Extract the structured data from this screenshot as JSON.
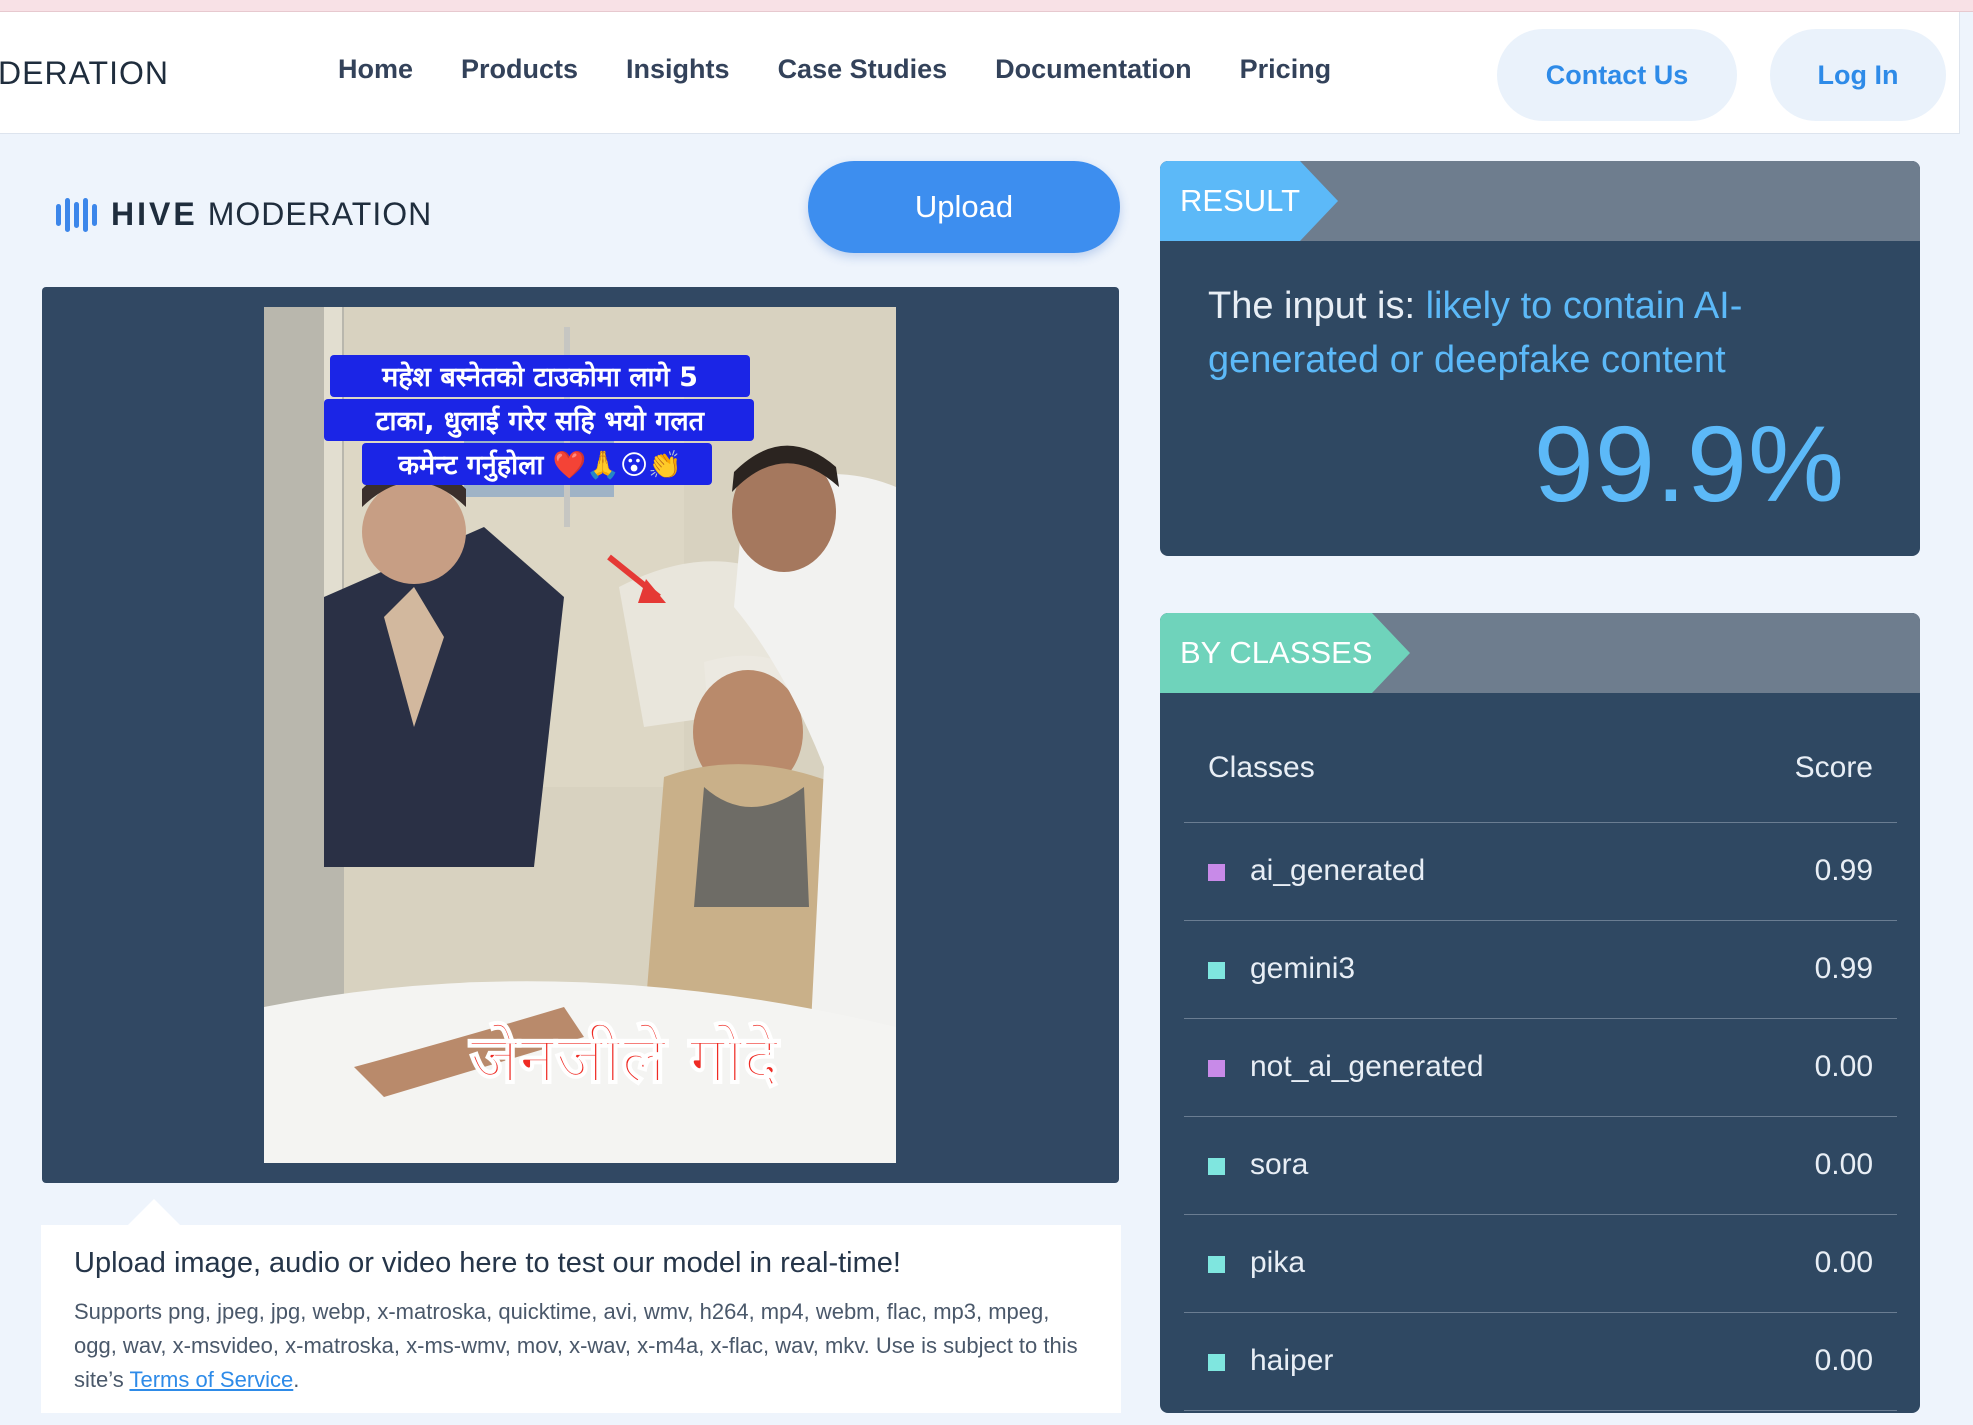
{
  "nav": {
    "brand_partial": "DERATION",
    "links": [
      "Home",
      "Products",
      "Insights",
      "Case Studies",
      "Documentation",
      "Pricing"
    ],
    "contact": "Contact Us",
    "login": "Log In"
  },
  "logo": {
    "hive": "HIVE",
    "moderation": "MODERATION",
    "icon": "hive-bars-icon"
  },
  "upload_button": "Upload",
  "preview": {
    "caption_top": [
      "महेश बस्नेतको टाउकोमा लागे 5",
      "टाका, धुलाई गरेर सहि भयो गलत",
      "कमेन्ट गर्नुहोला ❤️🙏😮👏"
    ],
    "caption_bottom": "जेनजीले गोदे"
  },
  "info": {
    "title": "Upload image, audio or video here to test our model in real-time!",
    "text": "Supports png, jpeg, jpg, webp, x-matroska, quicktime, avi, wmv, h264, mp4, webm, flac, mp3, mpeg, ogg, wav, x-msvideo, x-matroska, x-ms-wmv, mov, x-wav, x-m4a, x-flac, wav, mkv. Use is subject to this site’s ",
    "link": "Terms of Service",
    "after": "."
  },
  "result": {
    "tab": "RESULT",
    "prefix": "The input is: ",
    "verdict": "likely to contain AI-generated or deepfake content",
    "percent": "99.9%"
  },
  "classes": {
    "tab": "BY CLASSES",
    "header_classes": "Classes",
    "header_score": "Score",
    "rows": [
      {
        "name": "ai_generated",
        "score": "0.99",
        "color": "#c88ae8"
      },
      {
        "name": "gemini3",
        "score": "0.99",
        "color": "#7fe6df"
      },
      {
        "name": "not_ai_generated",
        "score": "0.00",
        "color": "#c88ae8"
      },
      {
        "name": "sora",
        "score": "0.00",
        "color": "#7fe6df"
      },
      {
        "name": "pika",
        "score": "0.00",
        "color": "#7fe6df"
      },
      {
        "name": "haiper",
        "score": "0.00",
        "color": "#7fe6df"
      }
    ]
  },
  "colors": {
    "accent": "#3d8eef",
    "result_blue": "#5cb9f8",
    "classes_green": "#6fd3bb",
    "panel_bg": "#2f4862"
  }
}
